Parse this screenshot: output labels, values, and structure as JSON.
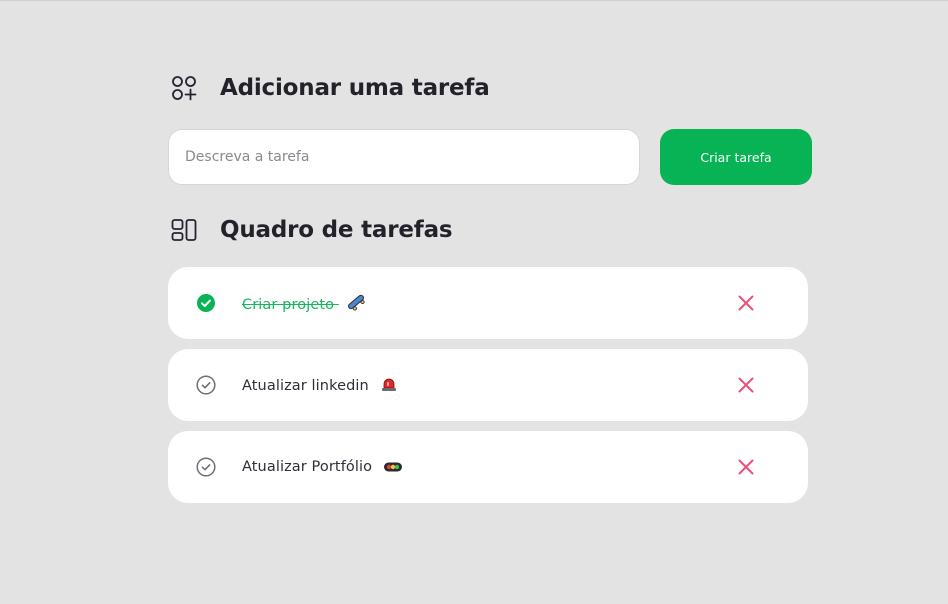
{
  "add_section": {
    "title": "Adicionar uma tarefa",
    "icon": "add-apps-icon"
  },
  "task_input": {
    "placeholder": "Descreva a tarefa",
    "value": ""
  },
  "create_button": {
    "label": "Criar tarefa"
  },
  "board_section": {
    "title": "Quadro de tarefas",
    "icon": "board-layout-icon"
  },
  "tasks": [
    {
      "text": "Criar projeto",
      "emoji": "skateboard-emoji",
      "completed": true
    },
    {
      "text": "Atualizar linkedin",
      "emoji": "siren-emoji",
      "completed": false
    },
    {
      "text": "Atualizar Portfólio",
      "emoji": "traffic-light-emoji",
      "completed": false
    }
  ],
  "colors": {
    "background": "#e3e3e3",
    "accent_green": "#08b356",
    "delete_pink": "#ec4f7a",
    "text_dark": "#23222b"
  }
}
